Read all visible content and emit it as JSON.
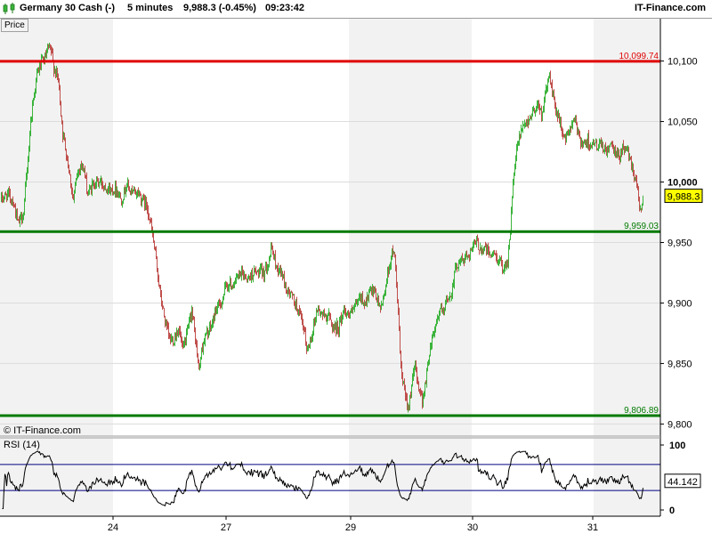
{
  "header": {
    "instrument": "Germany 30 Cash (-)",
    "timeframe": "5 minutes",
    "quote": "9,988.3 (-0.45%)",
    "time": "09:23:42",
    "brand": "IT-Finance.com"
  },
  "price_panel": {
    "tab_label": "Price",
    "watermark": "© IT-Finance.com",
    "current_price_label": "9,988.3"
  },
  "rsi_panel": {
    "title": "RSI (14)",
    "current_value_label": "44.142"
  },
  "colors": {
    "resistance": "#e00000",
    "support": "#007a00",
    "candle_up": "#3cb43c",
    "candle_down": "#c0504d",
    "rsi_line": "#000000",
    "rsi_bands": "#000080",
    "price_badge": "#ffff00",
    "weekend_shade": "#f2f2f2"
  },
  "chart_data": [
    {
      "type": "candlestick",
      "title": "Germany 30 Cash (-)",
      "ylabel": "Price",
      "ylim": [
        9790,
        10135
      ],
      "y_ticks": [
        {
          "value": 9800,
          "label": "9,800"
        },
        {
          "value": 9850,
          "label": "9,850"
        },
        {
          "value": 9900,
          "label": "9,900"
        },
        {
          "value": 9950,
          "label": "9,950"
        },
        {
          "value": 10000,
          "label": "10,000"
        },
        {
          "value": 10050,
          "label": "10,050"
        },
        {
          "value": 10100,
          "label": "10,100"
        }
      ],
      "x_categories": [
        "24",
        "27",
        "29",
        "30",
        "31"
      ],
      "horizontal_lines": [
        {
          "value": 10099.74,
          "label": "10,099.74",
          "role": "resistance"
        },
        {
          "value": 9959.03,
          "label": "9,959.03",
          "role": "support"
        },
        {
          "value": 9806.89,
          "label": "9,806.89",
          "role": "support"
        }
      ],
      "last_price": 9988.3,
      "anchors": [
        [
          0,
          9985
        ],
        [
          8,
          9990
        ],
        [
          14,
          9985
        ],
        [
          20,
          9965
        ],
        [
          26,
          9975
        ],
        [
          30,
          10010
        ],
        [
          34,
          10050
        ],
        [
          38,
          10075
        ],
        [
          42,
          10092
        ],
        [
          46,
          10098
        ],
        [
          50,
          10102
        ],
        [
          54,
          10110
        ],
        [
          57,
          10108
        ],
        [
          60,
          10095
        ],
        [
          65,
          10085
        ],
        [
          70,
          10040
        ],
        [
          74,
          10025
        ],
        [
          78,
          10005
        ],
        [
          82,
          9985
        ],
        [
          86,
          10005
        ],
        [
          90,
          10015
        ],
        [
          94,
          10010
        ],
        [
          98,
          9990
        ],
        [
          102,
          9995
        ],
        [
          106,
          10000
        ],
        [
          112,
          10000
        ],
        [
          118,
          9997
        ],
        [
          124,
          9993
        ],
        [
          130,
          9995
        ],
        [
          136,
          9985
        ],
        [
          142,
          9998
        ],
        [
          148,
          9990
        ],
        [
          154,
          9992
        ],
        [
          160,
          9985
        ],
        [
          165,
          9980
        ],
        [
          170,
          9960
        ],
        [
          175,
          9935
        ],
        [
          180,
          9905
        ],
        [
          185,
          9885
        ],
        [
          190,
          9870
        ],
        [
          195,
          9870
        ],
        [
          200,
          9880
        ],
        [
          205,
          9860
        ],
        [
          210,
          9875
        ],
        [
          215,
          9895
        ],
        [
          219,
          9870
        ],
        [
          223,
          9845
        ],
        [
          227,
          9865
        ],
        [
          232,
          9875
        ],
        [
          237,
          9880
        ],
        [
          242,
          9895
        ],
        [
          248,
          9900
        ],
        [
          254,
          9915
        ],
        [
          260,
          9915
        ],
        [
          266,
          9920
        ],
        [
          272,
          9925
        ],
        [
          278,
          9920
        ],
        [
          284,
          9925
        ],
        [
          290,
          9925
        ],
        [
          296,
          9925
        ],
        [
          301,
          9935
        ],
        [
          305,
          9945
        ],
        [
          310,
          9930
        ],
        [
          316,
          9925
        ],
        [
          322,
          9910
        ],
        [
          328,
          9905
        ],
        [
          334,
          9895
        ],
        [
          340,
          9880
        ],
        [
          345,
          9860
        ],
        [
          350,
          9875
        ],
        [
          356,
          9895
        ],
        [
          362,
          9890
        ],
        [
          368,
          9890
        ],
        [
          374,
          9880
        ],
        [
          380,
          9880
        ],
        [
          386,
          9895
        ],
        [
          392,
          9890
        ],
        [
          398,
          9895
        ],
        [
          404,
          9905
        ],
        [
          410,
          9900
        ],
        [
          416,
          9910
        ],
        [
          422,
          9905
        ],
        [
          428,
          9895
        ],
        [
          434,
          9920
        ],
        [
          438,
          9935
        ],
        [
          442,
          9945
        ],
        [
          446,
          9905
        ],
        [
          450,
          9845
        ],
        [
          454,
          9825
        ],
        [
          458,
          9815
        ],
        [
          462,
          9830
        ],
        [
          466,
          9850
        ],
        [
          470,
          9830
        ],
        [
          474,
          9820
        ],
        [
          478,
          9835
        ],
        [
          482,
          9860
        ],
        [
          486,
          9875
        ],
        [
          490,
          9885
        ],
        [
          494,
          9895
        ],
        [
          498,
          9890
        ],
        [
          502,
          9905
        ],
        [
          506,
          9905
        ],
        [
          510,
          9925
        ],
        [
          515,
          9935
        ],
        [
          520,
          9935
        ],
        [
          525,
          9940
        ],
        [
          530,
          9945
        ],
        [
          535,
          9950
        ],
        [
          540,
          9945
        ],
        [
          545,
          9945
        ],
        [
          550,
          9940
        ],
        [
          555,
          9940
        ],
        [
          560,
          9935
        ],
        [
          565,
          9930
        ],
        [
          570,
          9935
        ],
        [
          573,
          9960
        ],
        [
          576,
          10000
        ],
        [
          580,
          10025
        ],
        [
          584,
          10040
        ],
        [
          588,
          10045
        ],
        [
          592,
          10050
        ],
        [
          596,
          10055
        ],
        [
          600,
          10060
        ],
        [
          604,
          10065
        ],
        [
          608,
          10055
        ],
        [
          612,
          10070
        ],
        [
          616,
          10090
        ],
        [
          620,
          10075
        ],
        [
          624,
          10060
        ],
        [
          628,
          10050
        ],
        [
          632,
          10040
        ],
        [
          636,
          10035
        ],
        [
          640,
          10045
        ],
        [
          644,
          10050
        ],
        [
          648,
          10045
        ],
        [
          652,
          10035
        ],
        [
          656,
          10030
        ],
        [
          660,
          10035
        ],
        [
          665,
          10030
        ],
        [
          670,
          10030
        ],
        [
          675,
          10030
        ],
        [
          680,
          10025
        ],
        [
          685,
          10030
        ],
        [
          690,
          10025
        ],
        [
          695,
          10020
        ],
        [
          700,
          10030
        ],
        [
          705,
          10025
        ],
        [
          709,
          10015
        ],
        [
          713,
          10005
        ],
        [
          716,
          9995
        ],
        [
          719,
          9975
        ],
        [
          722,
          9988
        ]
      ]
    },
    {
      "type": "line",
      "title": "RSI (14)",
      "ylim": [
        0,
        100
      ],
      "y_ticks": [
        {
          "value": 0,
          "label": "0"
        },
        {
          "value": 100,
          "label": "100"
        }
      ],
      "bands": [
        70,
        30
      ],
      "last_value": 44.142
    }
  ]
}
